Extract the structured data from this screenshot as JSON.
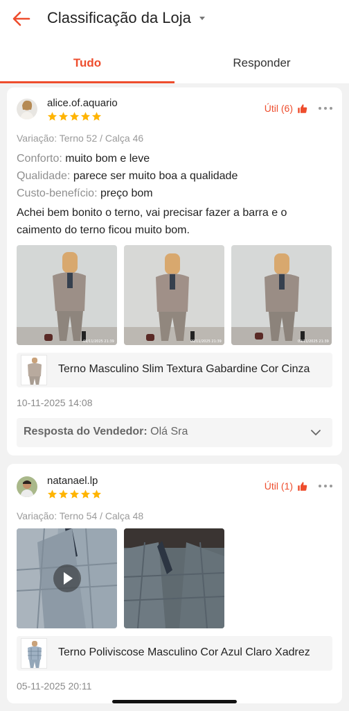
{
  "header": {
    "title": "Classificação da Loja"
  },
  "tabs": [
    {
      "label": "Tudo",
      "active": true
    },
    {
      "label": "Responder",
      "active": false
    }
  ],
  "colors": {
    "accent": "#ee4d2d",
    "star": "#ffb400"
  },
  "reviews": [
    {
      "username": "alice.of.aquario",
      "rating": 5,
      "helpful": "Útil (6)",
      "variation": "Variação: Terno 52 / Calça 46",
      "attributes": [
        {
          "key": "Conforto:",
          "value": "muito bom e leve"
        },
        {
          "key": "Qualidade:",
          "value": "parece ser muito boa a qualidade"
        },
        {
          "key": "Custo-benefício:",
          "value": "preço bom"
        }
      ],
      "comment": "Achei bem bonito o terno, vai precisar fazer a barra e o caimento do terno ficou muito bom.",
      "photo_timestamp": "09/11/2025 21:39",
      "product_name": "Terno Masculino Slim Textura Gabardine Cor Cinza",
      "date": "10-11-2025 14:08",
      "seller_reply_label": "Resposta do Vendedor:",
      "seller_reply_text": "Olá Sra"
    },
    {
      "username": "natanael.lp",
      "rating": 5,
      "helpful": "Útil (1)",
      "variation": "Variação: Terno 54 / Calça 48",
      "product_name": "Terno Poliviscose Masculino Cor Azul Claro Xadrez",
      "date": "05-11-2025 20:11"
    }
  ],
  "icons": {
    "back": "arrow-left-icon",
    "dropdown": "caret-down-icon",
    "star": "star-icon",
    "thumb": "thumbs-up-icon",
    "more": "more-dots-icon",
    "expand": "chevron-down-icon",
    "play": "play-icon"
  }
}
